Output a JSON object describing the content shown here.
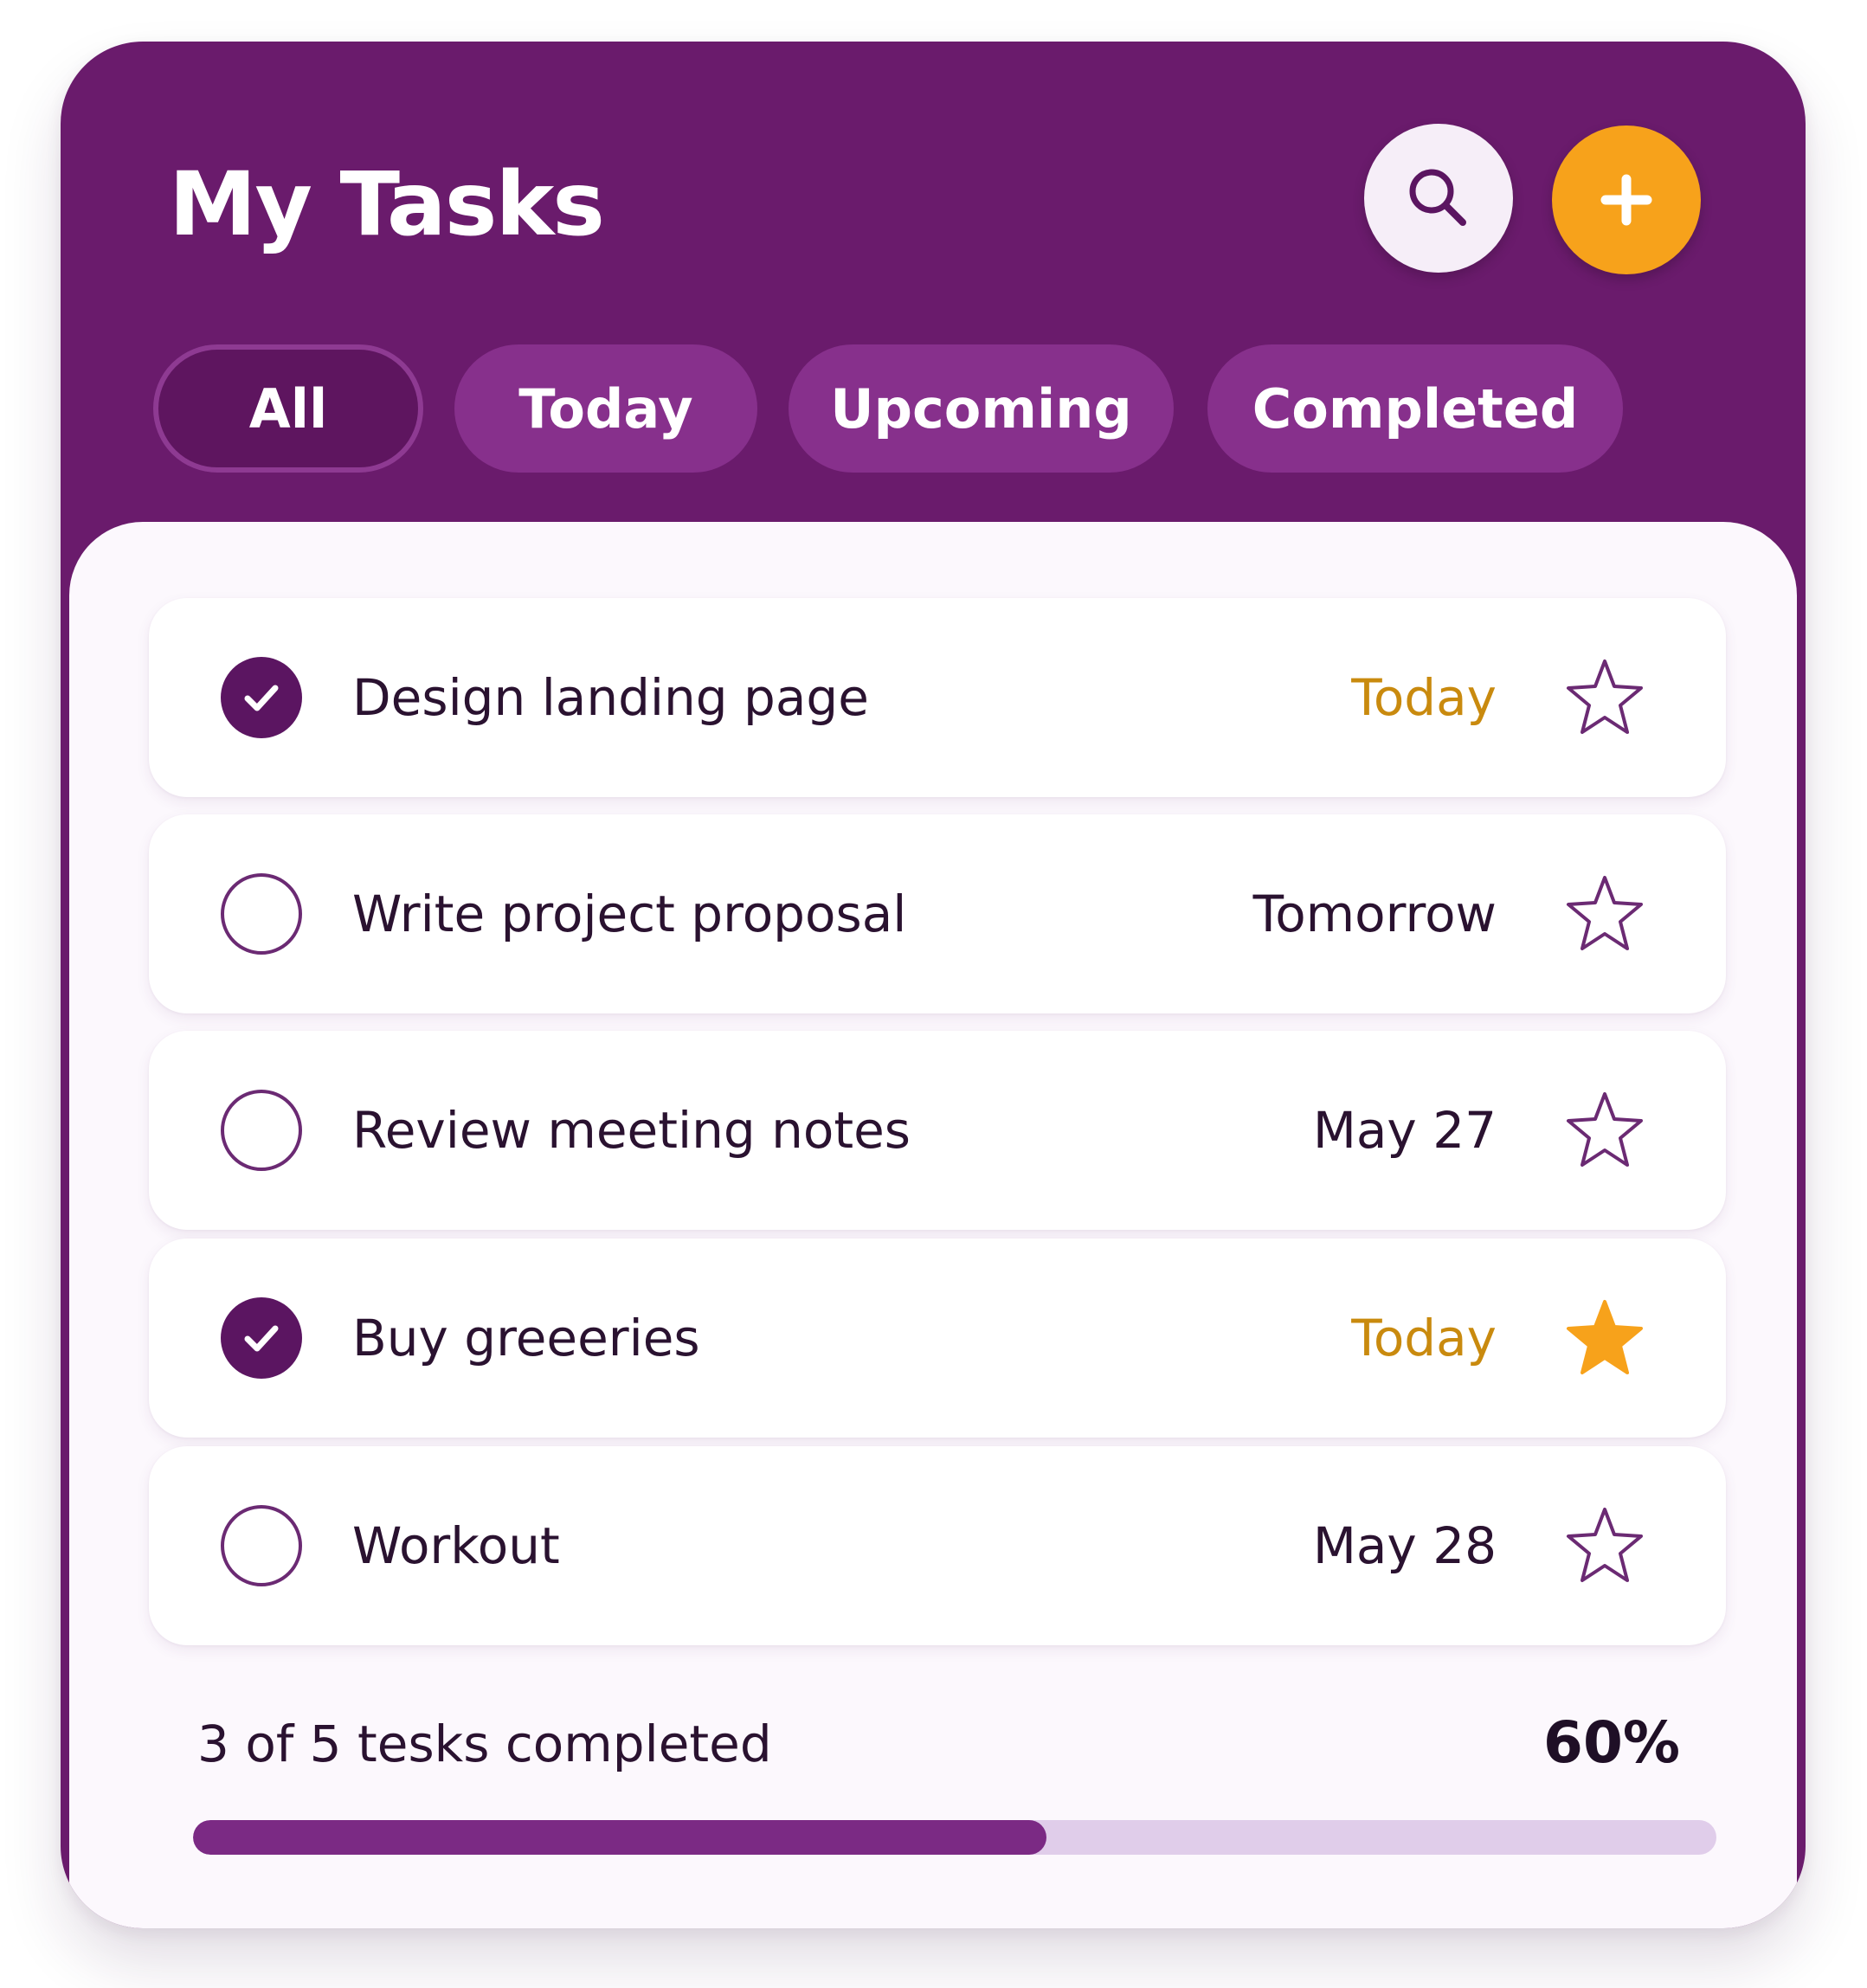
{
  "header": {
    "title": "My Tasks",
    "search_icon": "search-icon",
    "add_icon": "plus-icon"
  },
  "tabs": [
    {
      "label": "All",
      "active": true
    },
    {
      "label": "Today",
      "active": false
    },
    {
      "label": "Upcoming",
      "active": false
    },
    {
      "label": "Completed",
      "active": false
    }
  ],
  "tasks": [
    {
      "title": "Design landing page",
      "due": "Today",
      "done": true,
      "starred": false
    },
    {
      "title": "Write project proposal",
      "due": "Tomorrow",
      "done": false,
      "starred": false
    },
    {
      "title": "Review meeting notes",
      "due": "May 27",
      "done": false,
      "starred": false
    },
    {
      "title": "Buy greeeries",
      "due": "Today",
      "done": true,
      "starred": true
    },
    {
      "title": "Workout",
      "due": "May 28",
      "done": false,
      "starred": false
    }
  ],
  "progress": {
    "label": "3 of 5 tesks completed",
    "percent_label": "60%",
    "fraction": 0.56
  },
  "colors": {
    "header_bg": "#6a1b6c",
    "accent_orange": "#f7a21b",
    "today_text": "#c98a0e",
    "check_done": "#5b1561",
    "progress_fill": "#7b2a84",
    "progress_track": "#e0cdea"
  }
}
